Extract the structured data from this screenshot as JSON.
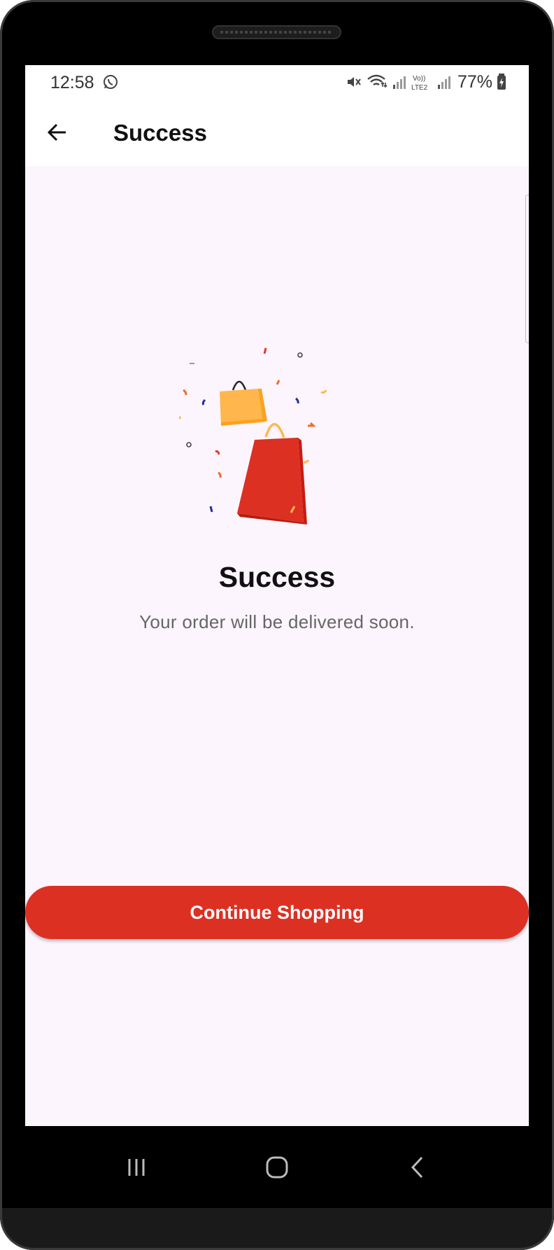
{
  "status_bar": {
    "time": "12:58",
    "battery": "77%",
    "network_label": "Vo)) LTE2"
  },
  "app_bar": {
    "title": "Success"
  },
  "content": {
    "heading": "Success",
    "message": "Your order will be delivered soon."
  },
  "cta": {
    "label": "Continue Shopping"
  },
  "colors": {
    "accent": "#dc3023",
    "screen_background": "#fcf5fd",
    "bag_orange": "#ffb74d",
    "bag_red": "#dc3023"
  }
}
